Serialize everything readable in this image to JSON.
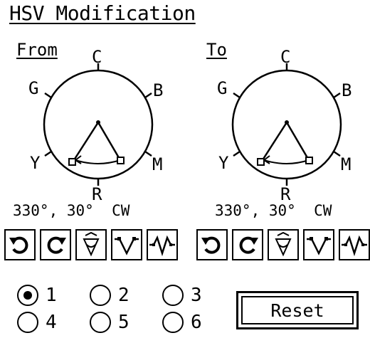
{
  "title": "HSV Modification",
  "from": {
    "label": "From",
    "dial_labels": {
      "top": "C",
      "upper_left": "G",
      "upper_right": "B",
      "lower_left": "Y",
      "lower_right": "M",
      "bottom": "R"
    },
    "readout": "330°, 30°  CW"
  },
  "to": {
    "label": "To",
    "dial_labels": {
      "top": "C",
      "upper_left": "G",
      "upper_right": "B",
      "lower_left": "Y",
      "lower_right": "M",
      "bottom": "R"
    },
    "readout": "330°, 30°  CW"
  },
  "tool_buttons": [
    "rotate-ccw-icon",
    "rotate-cw-icon",
    "flip-icon",
    "curve-peak-icon",
    "curve-wave-icon"
  ],
  "radio_options": [
    {
      "label": "1",
      "selected": true
    },
    {
      "label": "2",
      "selected": false
    },
    {
      "label": "3",
      "selected": false
    },
    {
      "label": "4",
      "selected": false
    },
    {
      "label": "5",
      "selected": false
    },
    {
      "label": "6",
      "selected": false
    }
  ],
  "reset_label": "Reset"
}
